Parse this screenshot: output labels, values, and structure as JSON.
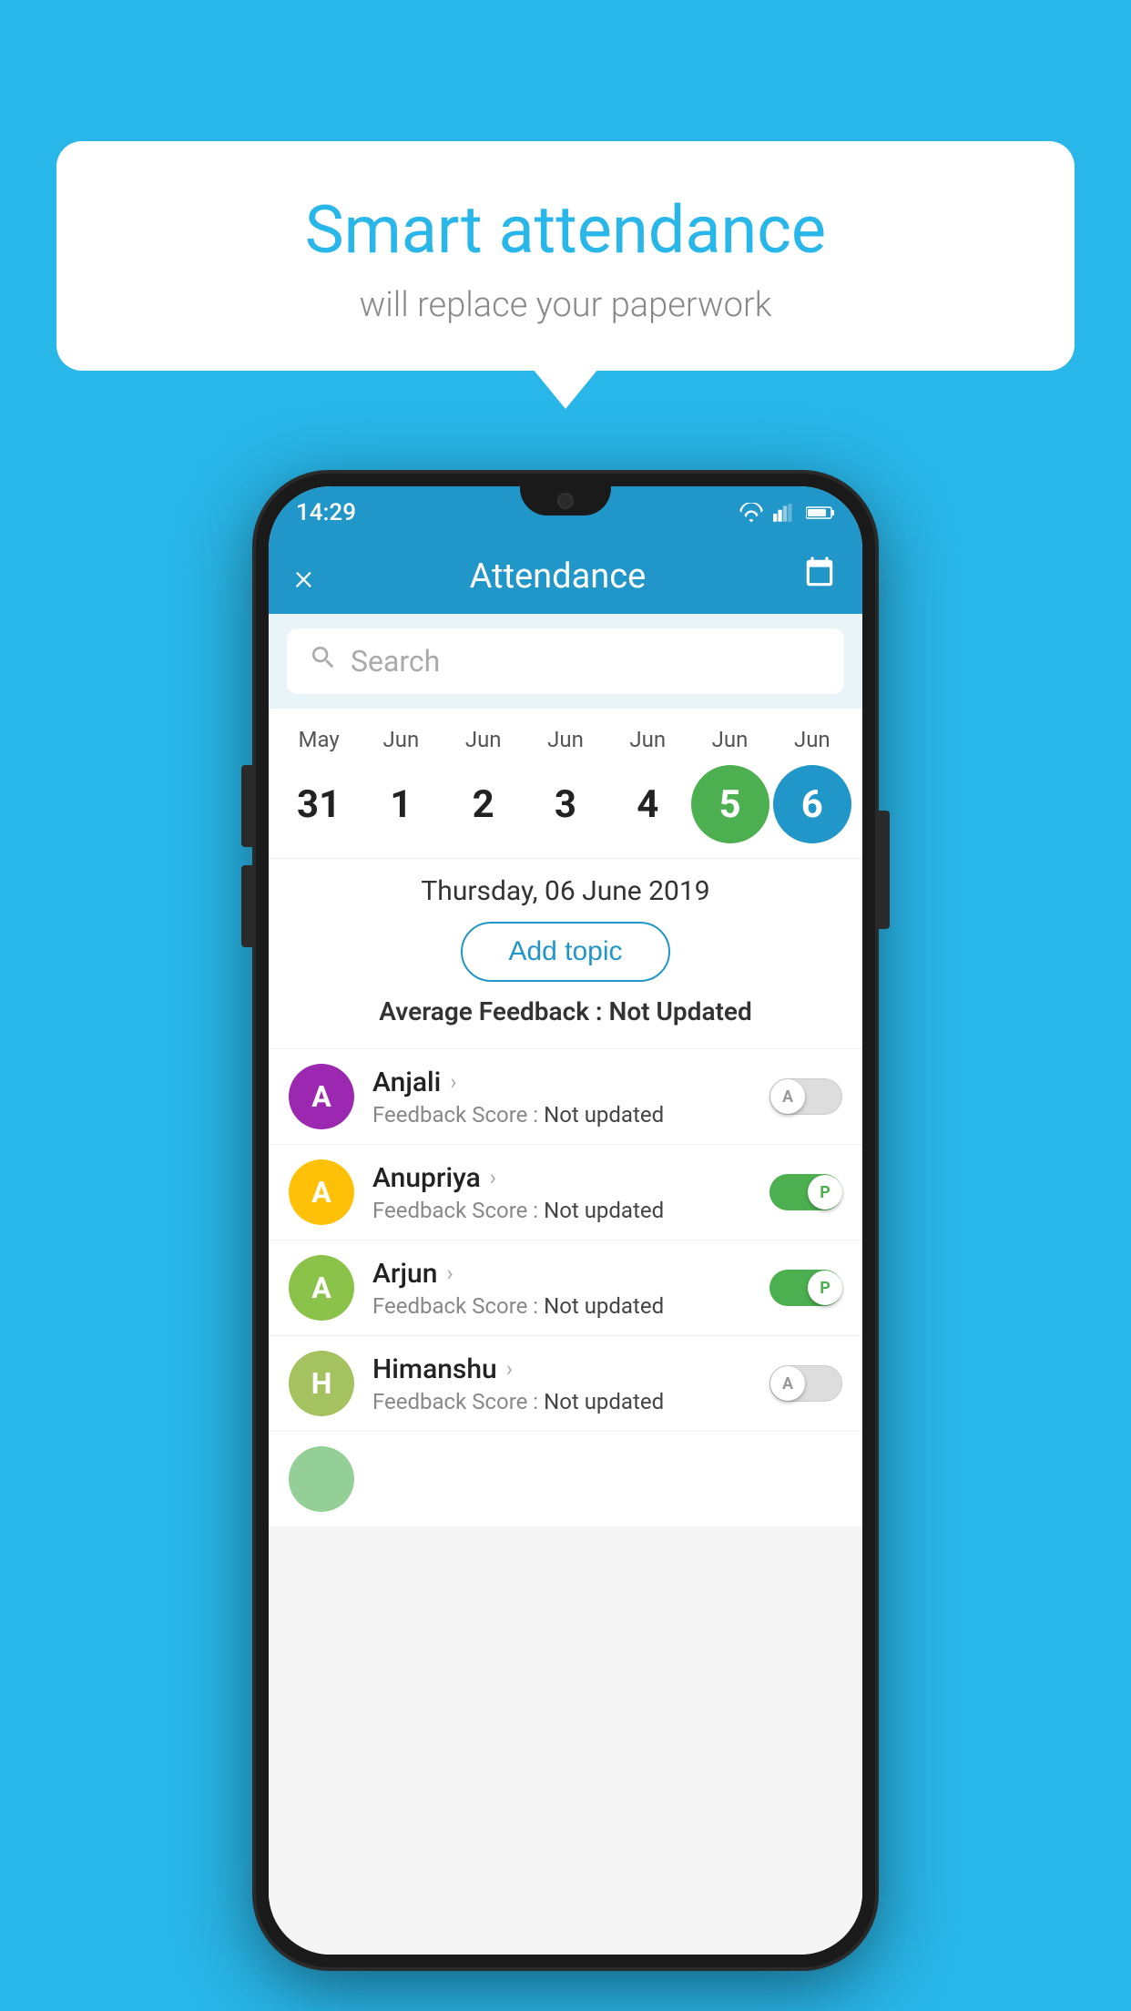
{
  "background_color": "#29b6e8",
  "speech_bubble": {
    "title": "Smart attendance",
    "subtitle": "will replace your paperwork"
  },
  "status_bar": {
    "time": "14:29",
    "signal_icon": "signal",
    "wifi_icon": "wifi",
    "battery_icon": "battery"
  },
  "app_bar": {
    "title": "Attendance",
    "close_label": "×",
    "calendar_icon": "calendar-icon"
  },
  "search": {
    "placeholder": "Search"
  },
  "calendar": {
    "months": [
      "May",
      "Jun",
      "Jun",
      "Jun",
      "Jun",
      "Jun",
      "Jun"
    ],
    "dates": [
      "31",
      "1",
      "2",
      "3",
      "4",
      "5",
      "6"
    ],
    "selected_index": 6,
    "today_index": 5
  },
  "selected_date": {
    "full_text": "Thursday, 06 June 2019",
    "add_topic_label": "Add topic",
    "avg_feedback_label": "Average Feedback :",
    "avg_feedback_value": "Not Updated"
  },
  "students": [
    {
      "name": "Anjali",
      "avatar_letter": "A",
      "avatar_color": "#9c27b0",
      "feedback_label": "Feedback Score :",
      "feedback_value": "Not updated",
      "toggle_state": "off",
      "toggle_label": "A"
    },
    {
      "name": "Anupriya",
      "avatar_letter": "A",
      "avatar_color": "#ffc107",
      "feedback_label": "Feedback Score :",
      "feedback_value": "Not updated",
      "toggle_state": "on",
      "toggle_label": "P"
    },
    {
      "name": "Arjun",
      "avatar_letter": "A",
      "avatar_color": "#8bc34a",
      "feedback_label": "Feedback Score :",
      "feedback_value": "Not updated",
      "toggle_state": "on",
      "toggle_label": "P"
    },
    {
      "name": "Himanshu",
      "avatar_letter": "H",
      "avatar_color": "#a5c261",
      "feedback_label": "Feedback Score :",
      "feedback_value": "Not updated",
      "toggle_state": "off",
      "toggle_label": "A"
    }
  ]
}
